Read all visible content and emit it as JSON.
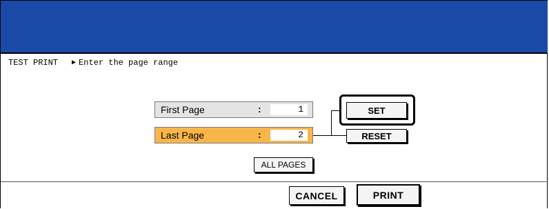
{
  "header": {
    "color": "#1a4aa8"
  },
  "breadcrumb": {
    "section": "TEST PRINT",
    "separator_icon": "right-triangle-icon",
    "instruction": "Enter the page range"
  },
  "fields": {
    "first_page": {
      "label": "First Page",
      "colon": ":",
      "value": "1"
    },
    "last_page": {
      "label": "Last Page",
      "colon": ":",
      "value": "2",
      "selected": true,
      "highlight_color": "#f8b64a"
    }
  },
  "buttons": {
    "set": "SET",
    "reset": "RESET",
    "all_pages": "ALL PAGES",
    "cancel": "CANCEL",
    "print": "PRINT"
  }
}
